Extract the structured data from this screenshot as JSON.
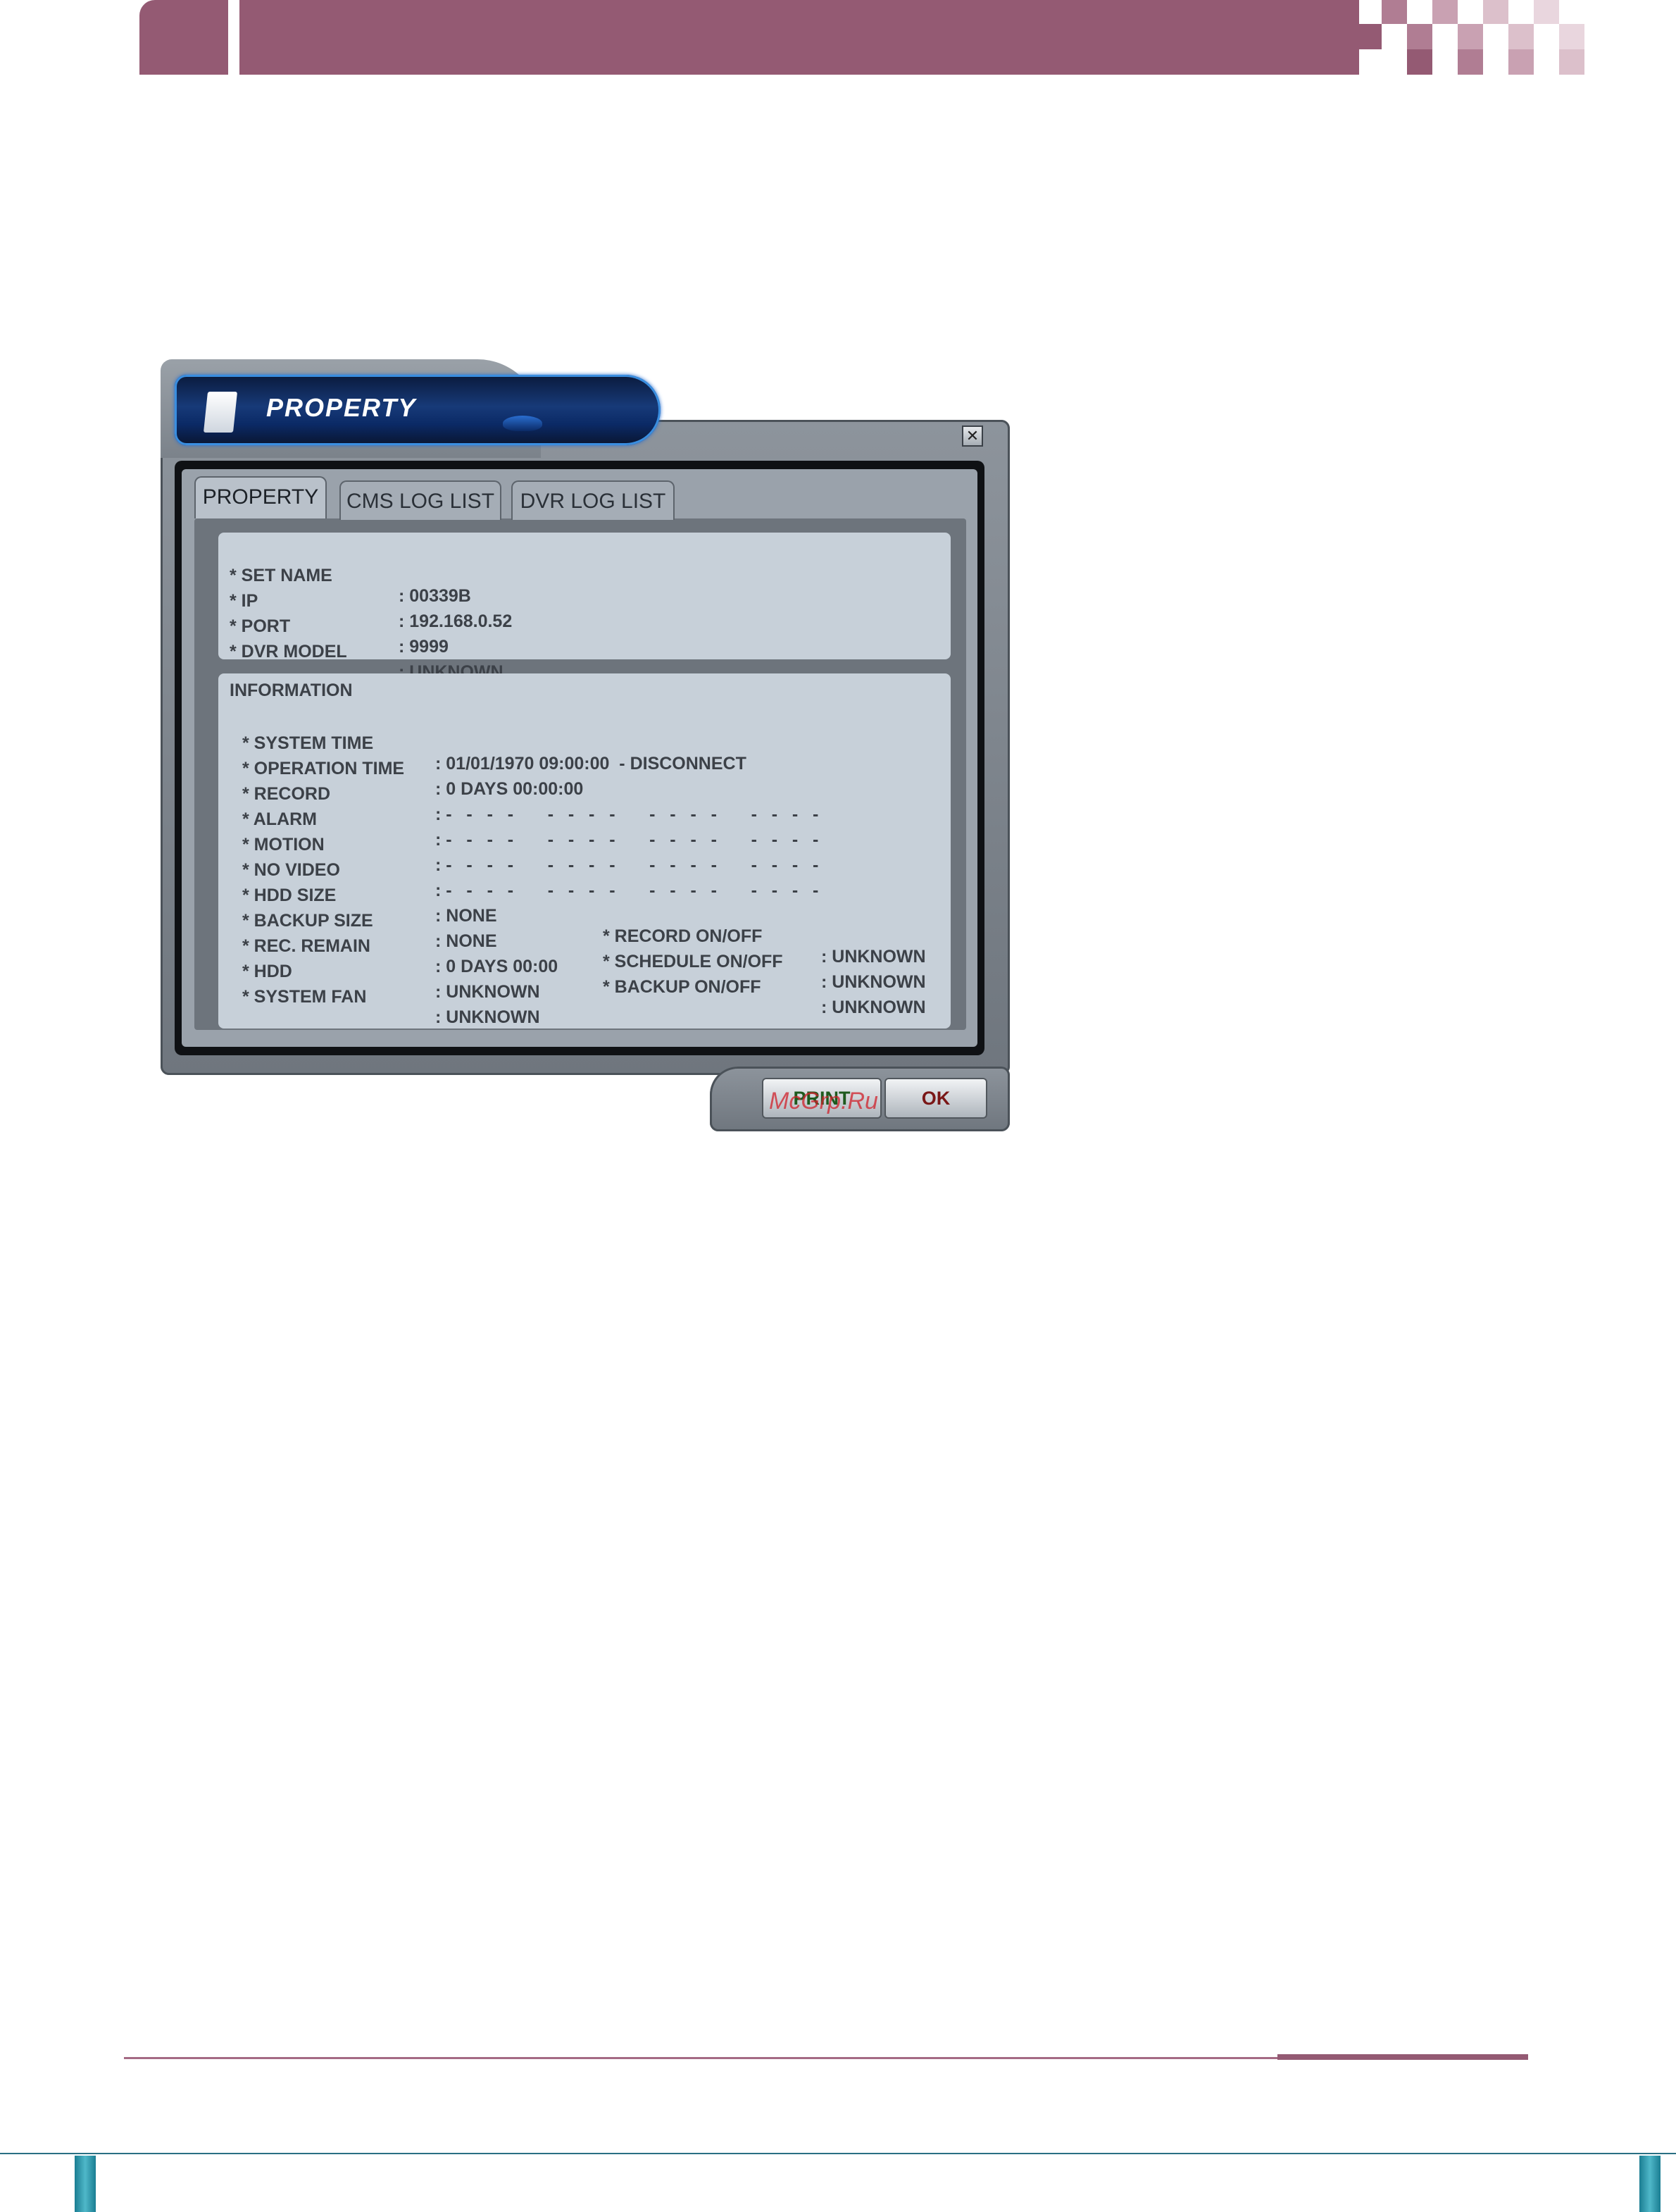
{
  "dialog": {
    "title": "PROPERTY",
    "close_symbol": "✕",
    "tabs": [
      {
        "label": "PROPERTY",
        "active": true
      },
      {
        "label": "CMS LOG LIST",
        "active": false
      },
      {
        "label": "DVR LOG LIST",
        "active": false
      }
    ],
    "property": [
      {
        "label": "* SET NAME",
        "value": ": 00339B"
      },
      {
        "label": "* IP",
        "value": ": 192.168.0.52"
      },
      {
        "label": "* PORT",
        "value": ": 9999"
      },
      {
        "label": "* DVR MODEL",
        "value": ": UNKNOWN"
      }
    ],
    "information": {
      "heading": "INFORMATION",
      "rows": [
        {
          "label": "* SYSTEM TIME",
          "value": ": 01/01/1970 09:00:00  - DISCONNECT"
        },
        {
          "label": "* OPERATION TIME",
          "value": ": 0 DAYS 00:00:00"
        },
        {
          "label": "* RECORD",
          "value": ": -   -   -   -       -   -   -   -       -   -   -   -       -   -   -   -"
        },
        {
          "label": "* ALARM",
          "value": ": -   -   -   -       -   -   -   -       -   -   -   -       -   -   -   -"
        },
        {
          "label": "* MOTION",
          "value": ": -   -   -   -       -   -   -   -       -   -   -   -       -   -   -   -"
        },
        {
          "label": "* NO VIDEO",
          "value": ": -   -   -   -       -   -   -   -       -   -   -   -       -   -   -   -"
        },
        {
          "label": "* HDD SIZE",
          "value": ": NONE",
          "label2": "* RECORD ON/OFF",
          "value2": ": UNKNOWN"
        },
        {
          "label": "* BACKUP SIZE",
          "value": ": NONE",
          "label2": "* SCHEDULE ON/OFF",
          "value2": ": UNKNOWN"
        },
        {
          "label": "* REC. REMAIN",
          "value": ": 0 DAYS 00:00",
          "label2": "* BACKUP ON/OFF",
          "value2": ": UNKNOWN"
        },
        {
          "label": "* HDD",
          "value": ": UNKNOWN"
        },
        {
          "label": "* SYSTEM FAN",
          "value": ": UNKNOWN"
        }
      ]
    },
    "buttons": {
      "print": "PRINT",
      "ok": "OK"
    }
  },
  "watermark": "McGrp.Ru",
  "colors": {
    "header_band": "#945a73",
    "footer_accent": "#945a73",
    "bottom_teal": "#2a6f83",
    "title_blue": "#173a78",
    "panel": "#c7d0d9"
  }
}
